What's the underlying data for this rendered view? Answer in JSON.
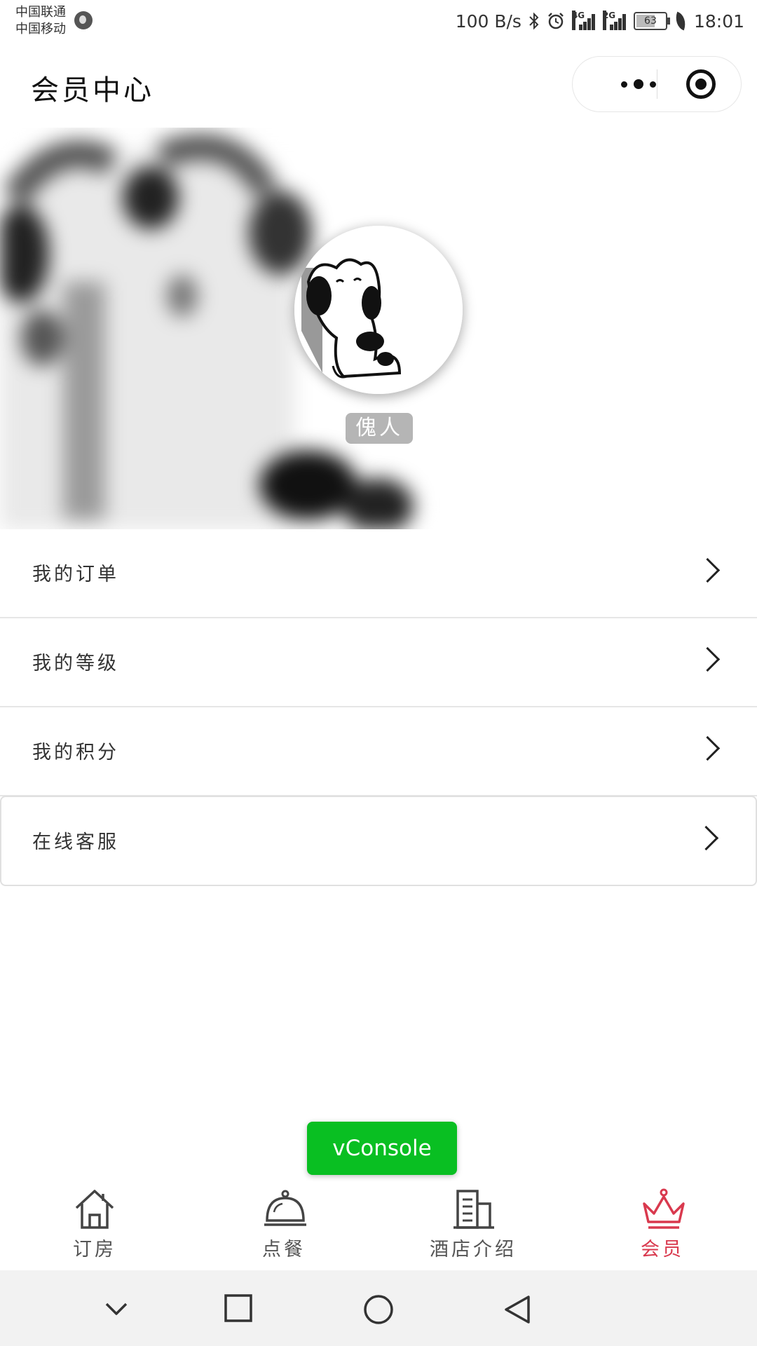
{
  "status_bar": {
    "carrier_1": "中国联通",
    "carrier_2": "中国移动",
    "net_speed": "100 B/s",
    "signal_1_tag": "4G",
    "signal_2_tag": "2G",
    "battery_level": "63",
    "time": "18:01"
  },
  "header": {
    "title": "会员中心"
  },
  "profile": {
    "nickname": "傀人"
  },
  "menu": {
    "items": [
      {
        "label": "我的订单"
      },
      {
        "label": "我的等级"
      },
      {
        "label": "我的积分"
      },
      {
        "label": "在线客服"
      }
    ]
  },
  "vconsole": {
    "label": "vConsole"
  },
  "tabbar": {
    "tabs": [
      {
        "label": "订房",
        "icon": "house-icon"
      },
      {
        "label": "点餐",
        "icon": "dining-cloche-icon"
      },
      {
        "label": "酒店介绍",
        "icon": "building-icon"
      },
      {
        "label": "会员",
        "icon": "crown-icon",
        "active": true
      }
    ],
    "active_color": "#d9394e",
    "inactive_color": "#555555"
  },
  "colors": {
    "vconsole_green": "#09bf22"
  }
}
